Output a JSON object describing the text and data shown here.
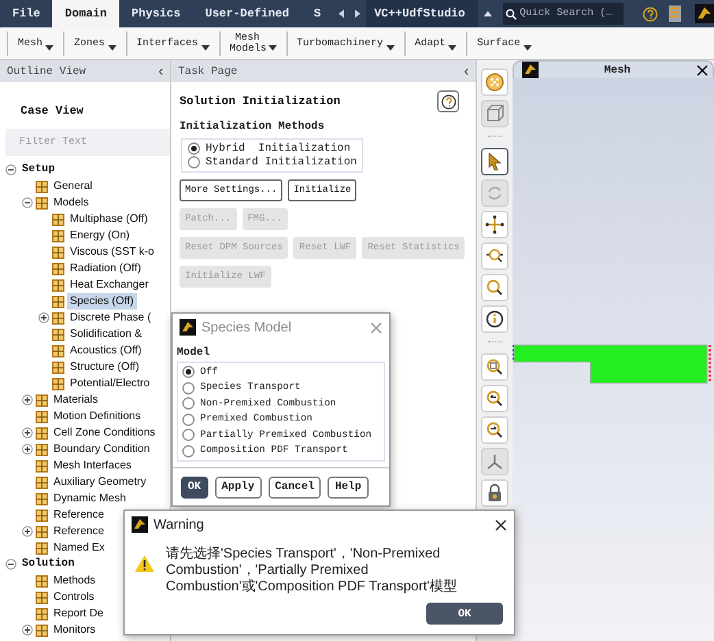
{
  "top_tabs": [
    {
      "label": "File",
      "selected": false
    },
    {
      "label": "Domain",
      "selected": true
    },
    {
      "label": "Physics",
      "selected": false
    },
    {
      "label": "User-Defined",
      "selected": false
    },
    {
      "label": "S",
      "selected": false
    }
  ],
  "addon_tab": "VC++UdfStudio",
  "search": {
    "placeholder": "Quick Search (…"
  },
  "ribbon": [
    "Mesh",
    "Zones",
    "Interfaces",
    "Mesh Models",
    "Turbomachinery",
    "Adapt",
    "Surface"
  ],
  "outline": {
    "title": "Outline View",
    "collapse": "‹",
    "case_view": "Case View",
    "filter": {
      "placeholder": "Filter Text"
    },
    "tree": [
      {
        "label": "Setup",
        "selected": false,
        "expanded": true,
        "children": [
          {
            "label": "General",
            "selected": false
          },
          {
            "label": "Models",
            "selected": false,
            "expanded": true,
            "children": [
              {
                "label": "Multiphase (Off)",
                "selected": false
              },
              {
                "label": "Energy (On)",
                "selected": false
              },
              {
                "label": "Viscous (SST k-o",
                "selected": false
              },
              {
                "label": "Radiation (Off)",
                "selected": false
              },
              {
                "label": "Heat Exchanger",
                "selected": false
              },
              {
                "label": "Species (Off)",
                "selected": true
              },
              {
                "label": "Discrete Phase (",
                "selected": false,
                "expanded": false
              },
              {
                "label": "Solidification &",
                "selected": false
              },
              {
                "label": "Acoustics (Off)",
                "selected": false
              },
              {
                "label": "Structure (Off)",
                "selected": false
              },
              {
                "label": "Potential/Electro",
                "selected": false
              }
            ]
          },
          {
            "label": "Materials",
            "selected": false,
            "expanded": false
          },
          {
            "label": "Motion Definitions",
            "selected": false
          },
          {
            "label": "Cell Zone Conditions",
            "selected": false,
            "expanded": false
          },
          {
            "label": "Boundary Condition",
            "selected": false,
            "expanded": false
          },
          {
            "label": "Mesh Interfaces",
            "selected": false
          },
          {
            "label": "Auxiliary Geometry",
            "selected": false
          },
          {
            "label": "Dynamic Mesh",
            "selected": false
          },
          {
            "label": "Reference",
            "selected": false
          },
          {
            "label": "Reference",
            "selected": false,
            "expanded": false
          },
          {
            "label": "Named Ex",
            "selected": false
          }
        ]
      },
      {
        "label": "Solution",
        "selected": false,
        "expanded": true,
        "children": [
          {
            "label": "Methods",
            "selected": false
          },
          {
            "label": "Controls",
            "selected": false
          },
          {
            "label": "Report De",
            "selected": false
          },
          {
            "label": "Monitors",
            "selected": false,
            "expanded": false
          }
        ]
      }
    ]
  },
  "task_page": {
    "title": "Task Page",
    "collapse": "‹",
    "heading": "Solution Initialization",
    "methods_label": "Initialization Methods",
    "methods": [
      {
        "label": "Hybrid  Initialization",
        "selected": true
      },
      {
        "label": "Standard Initialization",
        "selected": false
      }
    ],
    "button_rows": [
      [
        {
          "label": "More Settings...",
          "disabled": false
        },
        {
          "label": "Initialize",
          "disabled": false
        }
      ],
      [
        {
          "label": "Patch...",
          "disabled": true
        },
        {
          "label": "FMG...",
          "disabled": true
        }
      ],
      [
        {
          "label": "Reset DPM Sources",
          "disabled": true
        },
        {
          "label": "Reset LWF",
          "disabled": true
        },
        {
          "label": "Reset Statistics",
          "disabled": true
        }
      ],
      [
        {
          "label": "Initialize LWF",
          "disabled": true
        }
      ]
    ]
  },
  "toolbar": [
    {
      "selected": false,
      "disabled": false
    },
    {
      "selected": false,
      "disabled": true
    },
    {
      "selected": true,
      "disabled": false
    },
    {
      "selected": false,
      "disabled": true
    },
    {
      "selected": false,
      "disabled": false
    },
    {
      "selected": false,
      "disabled": false
    },
    {
      "selected": false,
      "disabled": false
    },
    {
      "selected": false,
      "disabled": false
    },
    {
      "selected": false,
      "disabled": false
    },
    {
      "selected": false,
      "disabled": false
    },
    {
      "selected": false,
      "disabled": false
    },
    {
      "selected": false,
      "disabled": true
    },
    {
      "selected": false,
      "disabled": false
    }
  ],
  "graphics": {
    "title": "Mesh"
  },
  "species_dialog": {
    "title": "Species Model",
    "group_label": "Model",
    "options": [
      {
        "label": "Off",
        "selected": true
      },
      {
        "label": "Species Transport",
        "selected": false
      },
      {
        "label": "Non-Premixed Combustion",
        "selected": false
      },
      {
        "label": "Premixed Combustion",
        "selected": false
      },
      {
        "label": "Partially Premixed Combustion",
        "selected": false
      },
      {
        "label": "Composition PDF Transport",
        "selected": false
      }
    ],
    "buttons": [
      {
        "label": "OK",
        "primary": true
      },
      {
        "label": "Apply",
        "primary": false
      },
      {
        "label": "Cancel",
        "primary": false
      },
      {
        "label": "Help",
        "primary": false
      }
    ]
  },
  "warning_dialog": {
    "title": "Warning",
    "message": "请先选择'Species Transport'，'Non-Premixed Combustion'，'Partially Premixed Combustion'或'Composition PDF Transport'模型",
    "button": "OK"
  }
}
